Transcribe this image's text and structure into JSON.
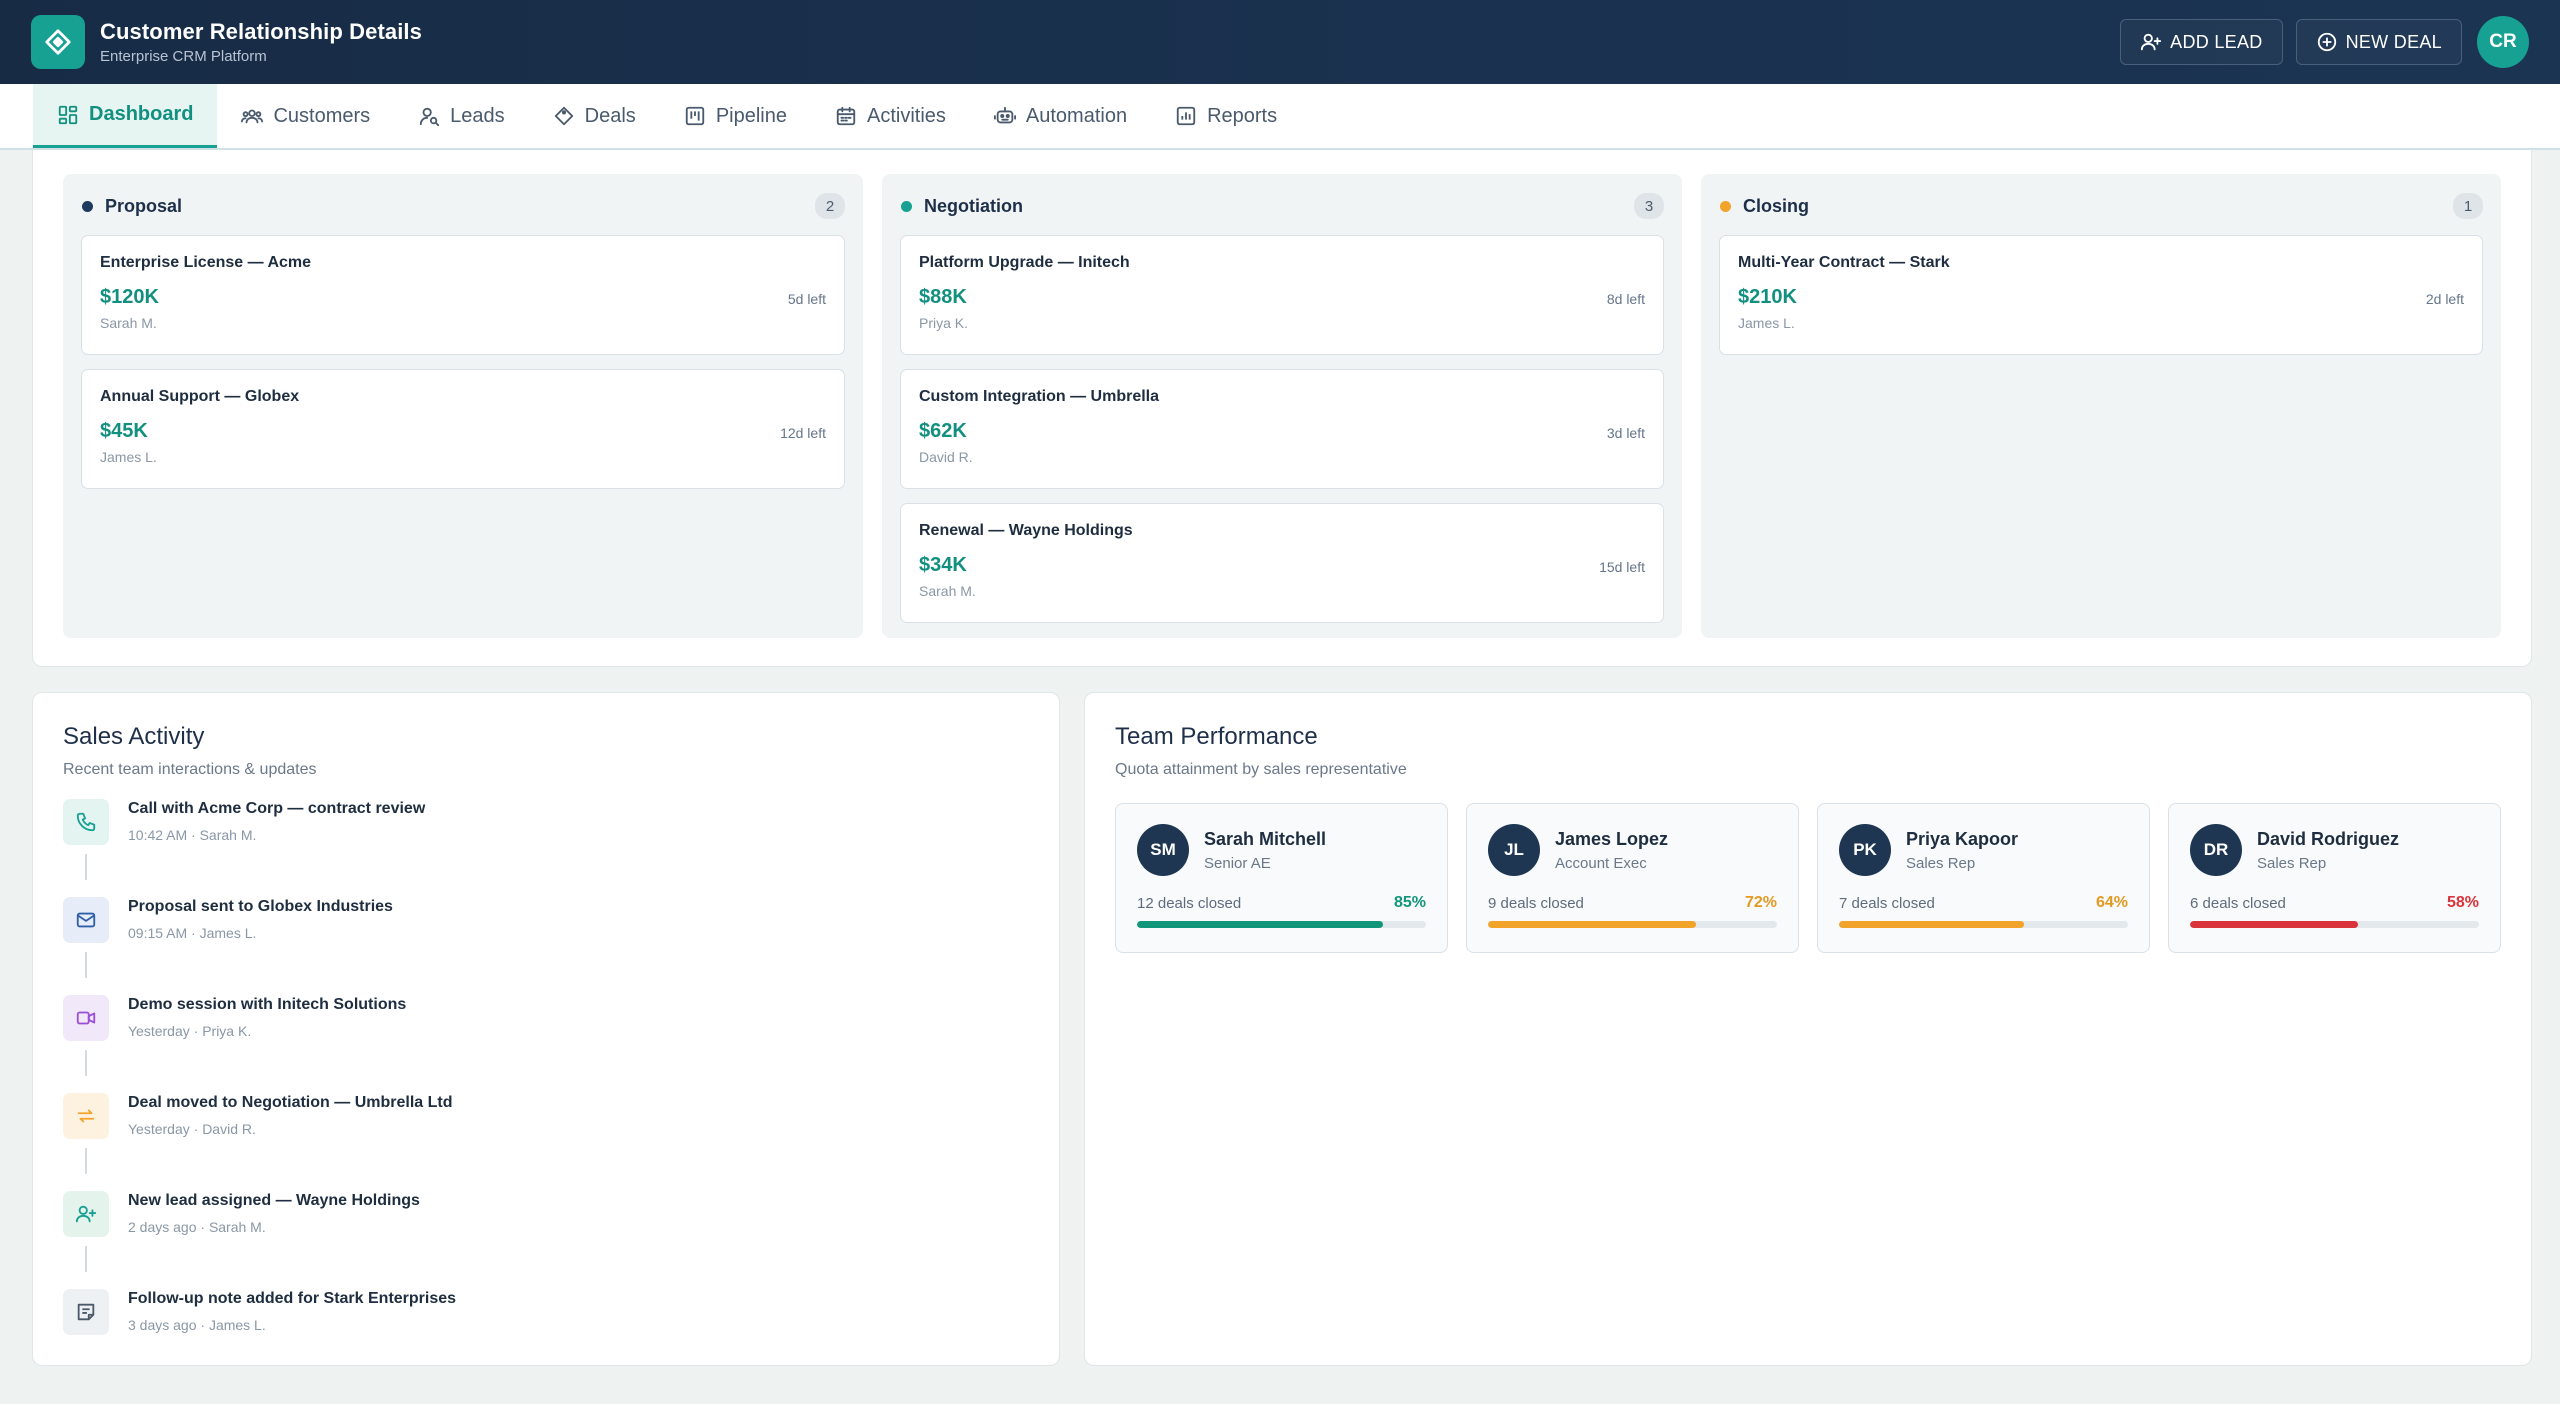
{
  "header": {
    "title": "Customer Relationship Details",
    "subtitle": "Enterprise CRM Platform",
    "add_lead": "ADD LEAD",
    "new_deal": "NEW DEAL",
    "user_initials": "CR"
  },
  "nav": {
    "items": [
      {
        "label": "Dashboard",
        "icon": "dashboard-icon",
        "active": true
      },
      {
        "label": "Customers",
        "icon": "customers-icon"
      },
      {
        "label": "Leads",
        "icon": "leads-icon"
      },
      {
        "label": "Deals",
        "icon": "deals-icon"
      },
      {
        "label": "Pipeline",
        "icon": "pipeline-icon"
      },
      {
        "label": "Activities",
        "icon": "calendar-icon"
      },
      {
        "label": "Automation",
        "icon": "robot-icon"
      },
      {
        "label": "Reports",
        "icon": "reports-icon"
      }
    ]
  },
  "pipeline": {
    "columns": [
      {
        "name": "Proposal",
        "count": "2",
        "color": "#1e3a5f",
        "deals": [
          {
            "title": "Enterprise License — Acme",
            "amount": "$120K",
            "owner": "Sarah M.",
            "left": "5d left"
          },
          {
            "title": "Annual Support — Globex",
            "amount": "$45K",
            "owner": "James L.",
            "left": "12d left"
          }
        ]
      },
      {
        "name": "Negotiation",
        "count": "3",
        "color": "#17a193",
        "deals": [
          {
            "title": "Platform Upgrade — Initech",
            "amount": "$88K",
            "owner": "Priya K.",
            "left": "8d left"
          },
          {
            "title": "Custom Integration — Umbrella",
            "amount": "$62K",
            "owner": "David R.",
            "left": "3d left"
          },
          {
            "title": "Renewal — Wayne Holdings",
            "amount": "$34K",
            "owner": "Sarah M.",
            "left": "15d left"
          }
        ]
      },
      {
        "name": "Closing",
        "count": "1",
        "color": "#f2a32a",
        "deals": [
          {
            "title": "Multi-Year Contract — Stark",
            "amount": "$210K",
            "owner": "James L.",
            "left": "2d left"
          }
        ]
      }
    ]
  },
  "activity": {
    "title": "Sales Activity",
    "subtitle": "Recent team interactions & updates",
    "items": [
      {
        "title": "Call with Acme Corp — contract review",
        "meta": "10:42 AM · Sarah M.",
        "icon": "phone-icon",
        "bg": "#e4f4f1",
        "fg": "#17a193"
      },
      {
        "title": "Proposal sent to Globex Industries",
        "meta": "09:15 AM · James L.",
        "icon": "mail-icon",
        "bg": "#e6edf8",
        "fg": "#2f5fa8"
      },
      {
        "title": "Demo session with Initech Solutions",
        "meta": "Yesterday · Priya K.",
        "icon": "video-icon",
        "bg": "#f1e8fa",
        "fg": "#9b4fd6"
      },
      {
        "title": "Deal moved to Negotiation — Umbrella Ltd",
        "meta": "Yesterday · David R.",
        "icon": "transfer-icon",
        "bg": "#fdf1e0",
        "fg": "#f2a32a"
      },
      {
        "title": "New lead assigned — Wayne Holdings",
        "meta": "2 days ago · Sarah M.",
        "icon": "user-plus-icon",
        "bg": "#e4f4ec",
        "fg": "#17a193"
      },
      {
        "title": "Follow-up note added for Stark Enterprises",
        "meta": "3 days ago · James L.",
        "icon": "note-icon",
        "bg": "#eef1f3",
        "fg": "#4b5a6a"
      }
    ]
  },
  "team": {
    "title": "Team Performance",
    "subtitle": "Quota attainment by sales representative",
    "members": [
      {
        "initials": "SM",
        "name": "Sarah Mitchell",
        "role": "Senior AE",
        "closed": "12 deals closed",
        "pct_label": "85%",
        "pct": 85,
        "color": "#11967a"
      },
      {
        "initials": "JL",
        "name": "James Lopez",
        "role": "Account Exec",
        "closed": "9 deals closed",
        "pct_label": "72%",
        "pct": 72,
        "color": "#f2a32a"
      },
      {
        "initials": "PK",
        "name": "Priya Kapoor",
        "role": "Sales Rep",
        "closed": "7 deals closed",
        "pct_label": "64%",
        "pct": 64,
        "color": "#f2a32a"
      },
      {
        "initials": "DR",
        "name": "David Rodriguez",
        "role": "Sales Rep",
        "closed": "6 deals closed",
        "pct_label": "58%",
        "pct": 58,
        "color": "#d9343b"
      }
    ]
  }
}
